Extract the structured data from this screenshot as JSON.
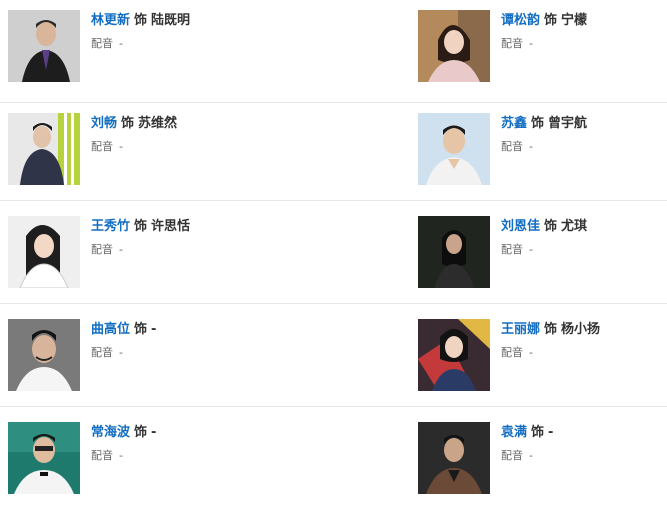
{
  "labels": {
    "shi": "饰",
    "dub": "配音"
  },
  "cast": [
    {
      "actor": "林更新",
      "role": "陆既明",
      "dub": "-",
      "icon": "actor-photo"
    },
    {
      "actor": "谭松韵",
      "role": "宁檬",
      "dub": "-",
      "icon": "actor-photo"
    },
    {
      "actor": "刘畅",
      "role": "苏维然",
      "dub": "-",
      "icon": "actor-photo"
    },
    {
      "actor": "苏鑫",
      "role": "曾宇航",
      "dub": "-",
      "icon": "actor-photo"
    },
    {
      "actor": "王秀竹",
      "role": "许思恬",
      "dub": "-",
      "icon": "actor-photo"
    },
    {
      "actor": "刘恩佳",
      "role": "尤琪",
      "dub": "-",
      "icon": "actor-photo"
    },
    {
      "actor": "曲高位",
      "role": "-",
      "dub": "-",
      "icon": "actor-photo"
    },
    {
      "actor": "王丽娜",
      "role": "杨小扬",
      "dub": "-",
      "icon": "actor-photo"
    },
    {
      "actor": "常海波",
      "role": "-",
      "dub": "-",
      "icon": "actor-photo"
    },
    {
      "actor": "袁满",
      "role": "-",
      "dub": "-",
      "icon": "actor-photo"
    }
  ],
  "colors": {
    "actor_link": "#136ec2",
    "divider": "#e8e8e8",
    "text": "#333333",
    "muted": "#666666"
  }
}
